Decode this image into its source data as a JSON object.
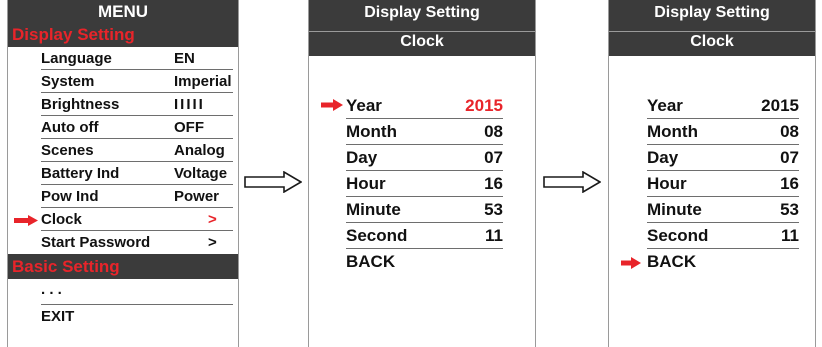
{
  "menu": {
    "title": "MENU",
    "sections": [
      {
        "header": "Display Setting",
        "items": [
          {
            "label": "Language",
            "value": "EN"
          },
          {
            "label": "System",
            "value": "Imperial"
          },
          {
            "label": "Brightness",
            "value": "IIIII"
          },
          {
            "label": "Auto off",
            "value": "OFF"
          },
          {
            "label": "Scenes",
            "value": "Analog"
          },
          {
            "label": "Battery Ind",
            "value": "Voltage"
          },
          {
            "label": "Pow Ind",
            "value": "Power"
          },
          {
            "label": "Clock",
            "value": ">",
            "selected": true
          },
          {
            "label": "Start Password",
            "value": ">"
          }
        ]
      },
      {
        "header": "Basic Setting",
        "items": [
          {
            "label": ". . ."
          },
          {
            "label": "EXIT"
          }
        ]
      }
    ]
  },
  "clock_screen_1": {
    "title": "Display Setting",
    "subtitle": "Clock",
    "selected": "Year",
    "rows": [
      {
        "label": "Year",
        "value": "2015"
      },
      {
        "label": "Month",
        "value": "08"
      },
      {
        "label": "Day",
        "value": "07"
      },
      {
        "label": "Hour",
        "value": "16"
      },
      {
        "label": "Minute",
        "value": "53"
      },
      {
        "label": "Second",
        "value": "11"
      },
      {
        "label": "BACK",
        "value": ""
      }
    ]
  },
  "clock_screen_2": {
    "title": "Display Setting",
    "subtitle": "Clock",
    "selected": "BACK",
    "rows": [
      {
        "label": "Year",
        "value": "2015"
      },
      {
        "label": "Month",
        "value": "08"
      },
      {
        "label": "Day",
        "value": "07"
      },
      {
        "label": "Hour",
        "value": "16"
      },
      {
        "label": "Minute",
        "value": "53"
      },
      {
        "label": "Second",
        "value": "11"
      },
      {
        "label": "BACK",
        "value": ""
      }
    ]
  },
  "icons": {
    "selection": "red-arrow-icon",
    "flow": "hollow-right-arrow-icon"
  },
  "colors": {
    "accent_red": "#e8242a",
    "title_bar": "#3b3b3b",
    "text": "#111111"
  }
}
